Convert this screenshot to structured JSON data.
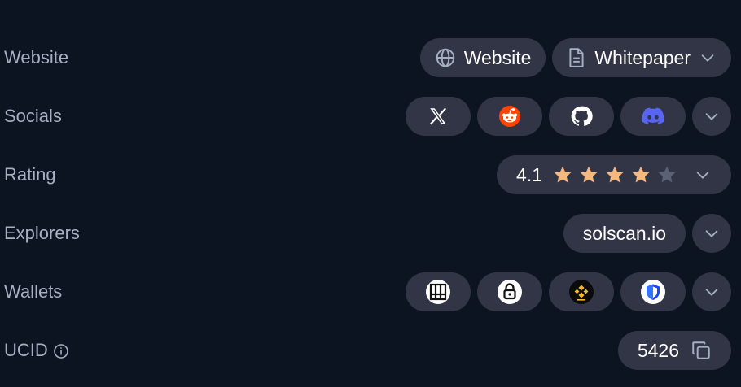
{
  "website": {
    "label": "Website",
    "website_button": "Website",
    "whitepaper_button": "Whitepaper"
  },
  "socials": {
    "label": "Socials",
    "icons": [
      "x-icon",
      "reddit-icon",
      "github-icon",
      "discord-icon"
    ]
  },
  "rating": {
    "label": "Rating",
    "value": "4.1",
    "stars_filled": 4,
    "stars_total": 5
  },
  "explorers": {
    "label": "Explorers",
    "primary": "solscan.io"
  },
  "wallets": {
    "label": "Wallets",
    "icons": [
      "grid-wallet-icon",
      "lock-wallet-icon",
      "binance-wallet-icon",
      "shield-wallet-icon"
    ]
  },
  "ucid": {
    "label": "UCID",
    "value": "5426"
  },
  "colors": {
    "background": "#0d1421",
    "pill": "#323546",
    "label": "#a6b0c3",
    "star_filled": "#f5b97f",
    "star_empty": "#5b6275",
    "reddit": "#ff4500",
    "discord": "#5865f2",
    "binance": "#f3ba2f",
    "shield_blue": "#1a47f5"
  }
}
